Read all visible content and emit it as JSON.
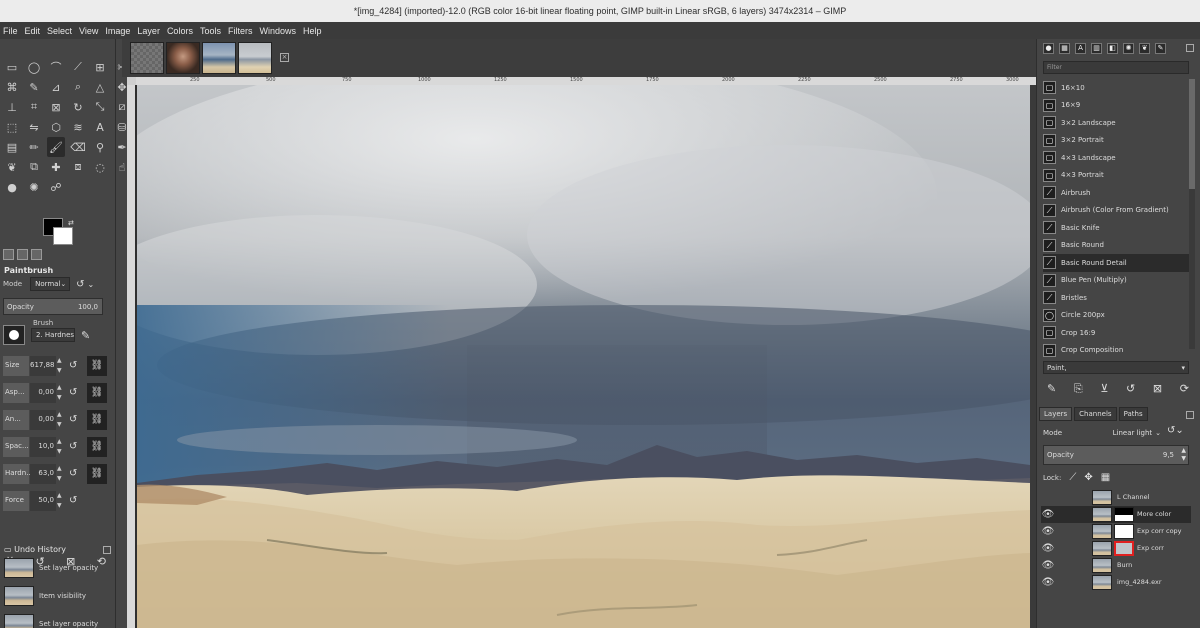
{
  "window": {
    "title": "*[img_4284] (imported)-12.0 (RGB color 16-bit linear floating point, GIMP built-in Linear sRGB, 6 layers) 3474x2314 – GIMP"
  },
  "menu": [
    "File",
    "Edit",
    "Select",
    "View",
    "Image",
    "Layer",
    "Colors",
    "Tools",
    "Filters",
    "Windows",
    "Help"
  ],
  "tool_options": {
    "title": "Paintbrush",
    "mode_label": "Mode",
    "mode_value": "Normal",
    "opacity_label": "Opacity",
    "opacity_value": "100,0",
    "brush_label": "Brush",
    "brush_value": "2. Hardness 0",
    "params": [
      {
        "label": "Size",
        "value": "617,88"
      },
      {
        "label": "Asp...",
        "value": "0,00"
      },
      {
        "label": "An...",
        "value": "0,00"
      },
      {
        "label": "Spac...",
        "value": "10,0"
      },
      {
        "label": "Hardn...",
        "value": "63,0"
      },
      {
        "label": "Force",
        "value": "50,0"
      }
    ]
  },
  "undo": {
    "title": "Undo History",
    "items": [
      "Set layer opacity",
      "Item visibility",
      "Set layer opacity"
    ]
  },
  "image_tabs_count": 4,
  "ruler_labels": [
    "250",
    "500",
    "750",
    "1000",
    "1250",
    "1500",
    "1750",
    "2000",
    "2250",
    "2500",
    "2750",
    "3000"
  ],
  "brushes": {
    "filter_placeholder": "Filter",
    "items": [
      "16×10",
      "16×9",
      "3×2 Landscape",
      "3×2 Portrait",
      "4×3 Landscape",
      "4×3 Portrait",
      "Airbrush",
      "Airbrush (Color From Gradient)",
      "Basic Knife",
      "Basic Round",
      "Basic Round Detail",
      "Blue Pen (Multiply)",
      "Bristles",
      "Circle 200px",
      "Crop 16:9",
      "Crop Composition"
    ],
    "selected_index": 10,
    "tag": "Paint,"
  },
  "layers": {
    "tabs": [
      "Layers",
      "Channels",
      "Paths"
    ],
    "mode_label": "Mode",
    "mode_value": "Linear light",
    "opacity_label": "Opacity",
    "opacity_value": "9,5",
    "lock_label": "Lock:",
    "items": [
      {
        "name": "L Channel",
        "mask": "none",
        "visible": false
      },
      {
        "name": "More color",
        "mask": "black",
        "visible": true
      },
      {
        "name": "Exp corr copy",
        "mask": "white",
        "visible": true
      },
      {
        "name": "Exp corr",
        "mask": "red",
        "visible": true
      },
      {
        "name": "Burn",
        "mask": "none",
        "visible": true
      },
      {
        "name": "img_4284.exr",
        "mask": "none",
        "visible": true
      }
    ],
    "selected_index": 1
  }
}
